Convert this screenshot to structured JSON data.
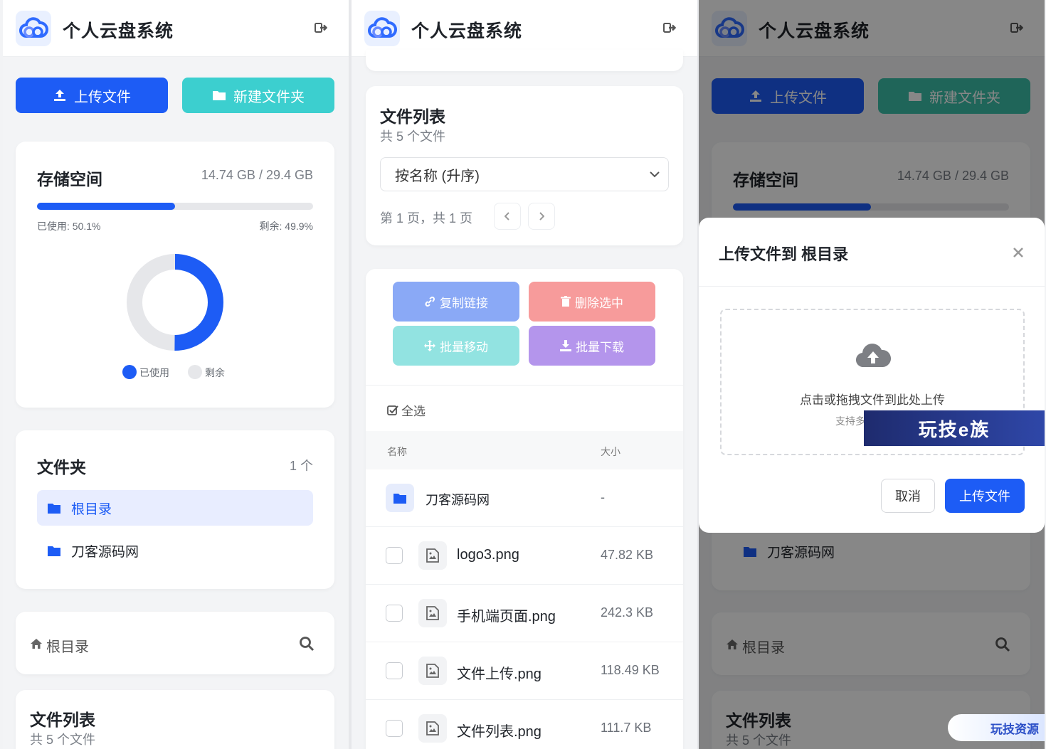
{
  "app": {
    "title": "个人云盘系统"
  },
  "toolbar": {
    "upload_label": "上传文件",
    "new_folder_label": "新建文件夹"
  },
  "storage": {
    "title": "存储空间",
    "usage_text": "14.74 GB / 29.4 GB",
    "used_label": "已使用: 50.1%",
    "free_label": "剩余: 49.9%",
    "used_fraction": 0.501,
    "legend_used": "已使用",
    "legend_free": "剩余",
    "colors": {
      "used": "#1d5cf5",
      "free": "#e6e7ea"
    }
  },
  "folders": {
    "title": "文件夹",
    "count": "1 个",
    "items": [
      {
        "label": "根目录"
      },
      {
        "label": "刀客源码网"
      }
    ]
  },
  "breadcrumb": {
    "label": "根目录"
  },
  "file_list": {
    "title": "文件列表",
    "subtitle": "共 5 个文件",
    "sort_selected": "按名称 (升序)",
    "page_info": "第 1 页，共 1 页",
    "actions": {
      "copy_link": "复制链接",
      "delete_selected": "删除选中",
      "batch_move": "批量移动",
      "batch_download": "批量下载"
    },
    "select_all": "全选",
    "columns": {
      "name": "名称",
      "size": "大小"
    },
    "rows": [
      {
        "name": "刀客源码网",
        "size": "-",
        "type": "folder"
      },
      {
        "name": "logo3.png",
        "size": "47.82 KB",
        "type": "image"
      },
      {
        "name": "手机端页面.png",
        "size": "242.3 KB",
        "type": "image"
      },
      {
        "name": "文件上传.png",
        "size": "118.49 KB",
        "type": "image"
      },
      {
        "name": "文件列表.png",
        "size": "111.7 KB",
        "type": "image"
      }
    ]
  },
  "upload_modal": {
    "title": "上传文件到 根目录",
    "drop_text": "点击或拖拽文件到此处上传",
    "drop_hint": "支持多",
    "cancel_label": "取消",
    "submit_label": "上传文件"
  },
  "watermarks": {
    "banner": "玩技e族",
    "corner": "玩技资源"
  }
}
